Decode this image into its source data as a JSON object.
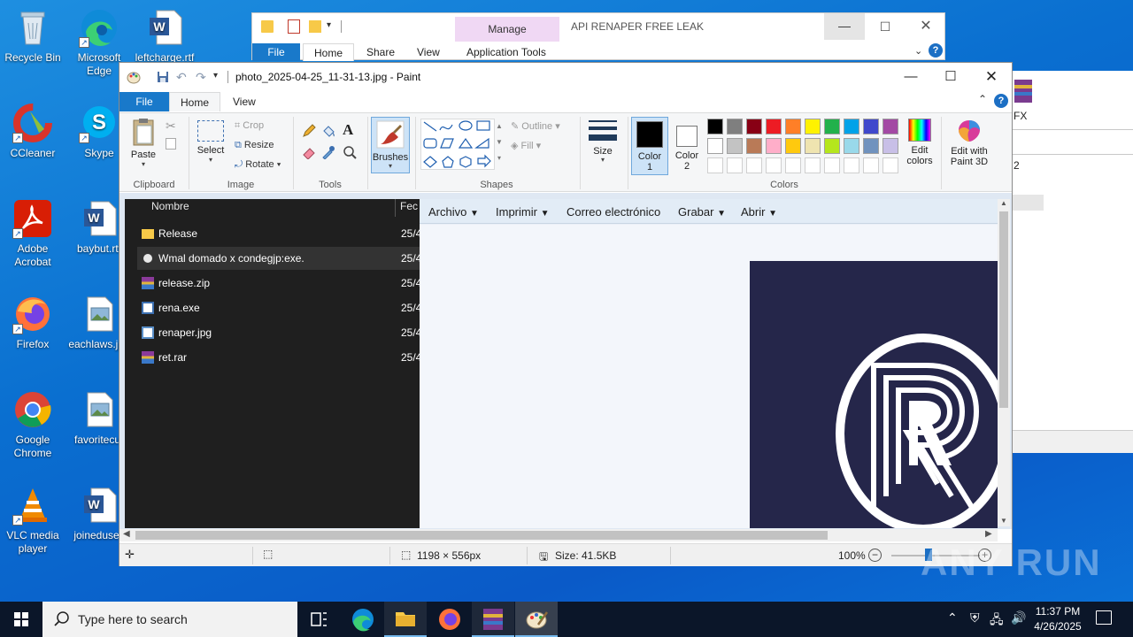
{
  "desktop": {
    "icons": [
      {
        "label": "Recycle Bin",
        "icon": "recycle-bin-icon"
      },
      {
        "label": "Microsoft Edge",
        "icon": "edge-icon"
      },
      {
        "label": "leftcharge.rtf",
        "icon": "word-doc-icon"
      },
      {
        "label": "CCleaner",
        "icon": "ccleaner-icon"
      },
      {
        "label": "Skype",
        "icon": "skype-icon"
      },
      {
        "label": "Adobe Acrobat",
        "icon": "acrobat-icon"
      },
      {
        "label": "baybut.rtf",
        "icon": "word-doc-icon"
      },
      {
        "label": "Firefox",
        "icon": "firefox-icon"
      },
      {
        "label": "eachlaws.jpg",
        "icon": "image-file-icon"
      },
      {
        "label": "Google Chrome",
        "icon": "chrome-icon"
      },
      {
        "label": "favoritecur",
        "icon": "image-file-icon"
      },
      {
        "label": "VLC media player",
        "icon": "vlc-icon"
      },
      {
        "label": "joineduses",
        "icon": "word-doc-icon"
      }
    ]
  },
  "explorer": {
    "title": "API RENAPER  FREE LEAK",
    "context_tab": "Manage",
    "tabs": [
      "File",
      "Home",
      "Share",
      "View",
      "Application Tools"
    ]
  },
  "behind_window": {
    "label_fx": "FX",
    "label_2": "2"
  },
  "paint": {
    "title": "photo_2025-04-25_11-31-13.jpg - Paint",
    "tabs": {
      "file": "File",
      "home": "Home",
      "view": "View"
    },
    "clipboard": {
      "paste": "Paste",
      "group": "Clipboard"
    },
    "image": {
      "select": "Select",
      "crop": "Crop",
      "resize": "Resize",
      "rotate": "Rotate",
      "group": "Image"
    },
    "tools": {
      "group": "Tools"
    },
    "brushes": "Brushes",
    "shapes": {
      "outline": "Outline",
      "fill": "Fill",
      "group": "Shapes"
    },
    "size": "Size",
    "color1": {
      "label": "Color",
      "num": "1"
    },
    "color2": {
      "label": "Color",
      "num": "2"
    },
    "colors_group": "Colors",
    "edit_colors": {
      "l1": "Edit",
      "l2": "colors"
    },
    "edit_3d": {
      "l1": "Edit with",
      "l2": "Paint 3D"
    },
    "palette_row1": [
      "#000000",
      "#7f7f7f",
      "#880015",
      "#ed1c24",
      "#ff7f27",
      "#fff200",
      "#22b14c",
      "#00a2e8",
      "#3f48cc",
      "#a349a4"
    ],
    "palette_row2": [
      "#ffffff",
      "#c3c3c3",
      "#b97a57",
      "#ffaec9",
      "#ffc90e",
      "#efe4b0",
      "#b5e61d",
      "#99d9ea",
      "#7092be",
      "#c8bfe7"
    ],
    "status": {
      "dimensions": "1198 × 556px",
      "size": "Size: 41.5KB",
      "zoom": "100%"
    }
  },
  "canvas": {
    "file_header": {
      "name": "Nombre",
      "date": "Fec"
    },
    "files": [
      {
        "name": "Release",
        "date": "25/4",
        "icon": "folder-icon"
      },
      {
        "name": "Wmal domado x condegjp:exe.",
        "date": "25/4",
        "icon": "exe-icon"
      },
      {
        "name": "release.zip",
        "date": "25/4",
        "icon": "winrar-icon"
      },
      {
        "name": "rena.exe",
        "date": "25/4",
        "icon": "app-icon"
      },
      {
        "name": "renaper.jpg",
        "date": "25/4",
        "icon": "image-icon"
      },
      {
        "name": "ret.rar",
        "date": "25/4",
        "icon": "winrar-icon"
      }
    ],
    "menu": {
      "archivo": "Archivo",
      "imprimir": "Imprimir",
      "correo": "Correo electrónico",
      "grabar": "Grabar",
      "abrir": "Abrir"
    }
  },
  "taskbar": {
    "search_placeholder": "Type here to search",
    "time": "11:37 PM",
    "date": "4/26/2025"
  },
  "watermark": "ANY RUN"
}
